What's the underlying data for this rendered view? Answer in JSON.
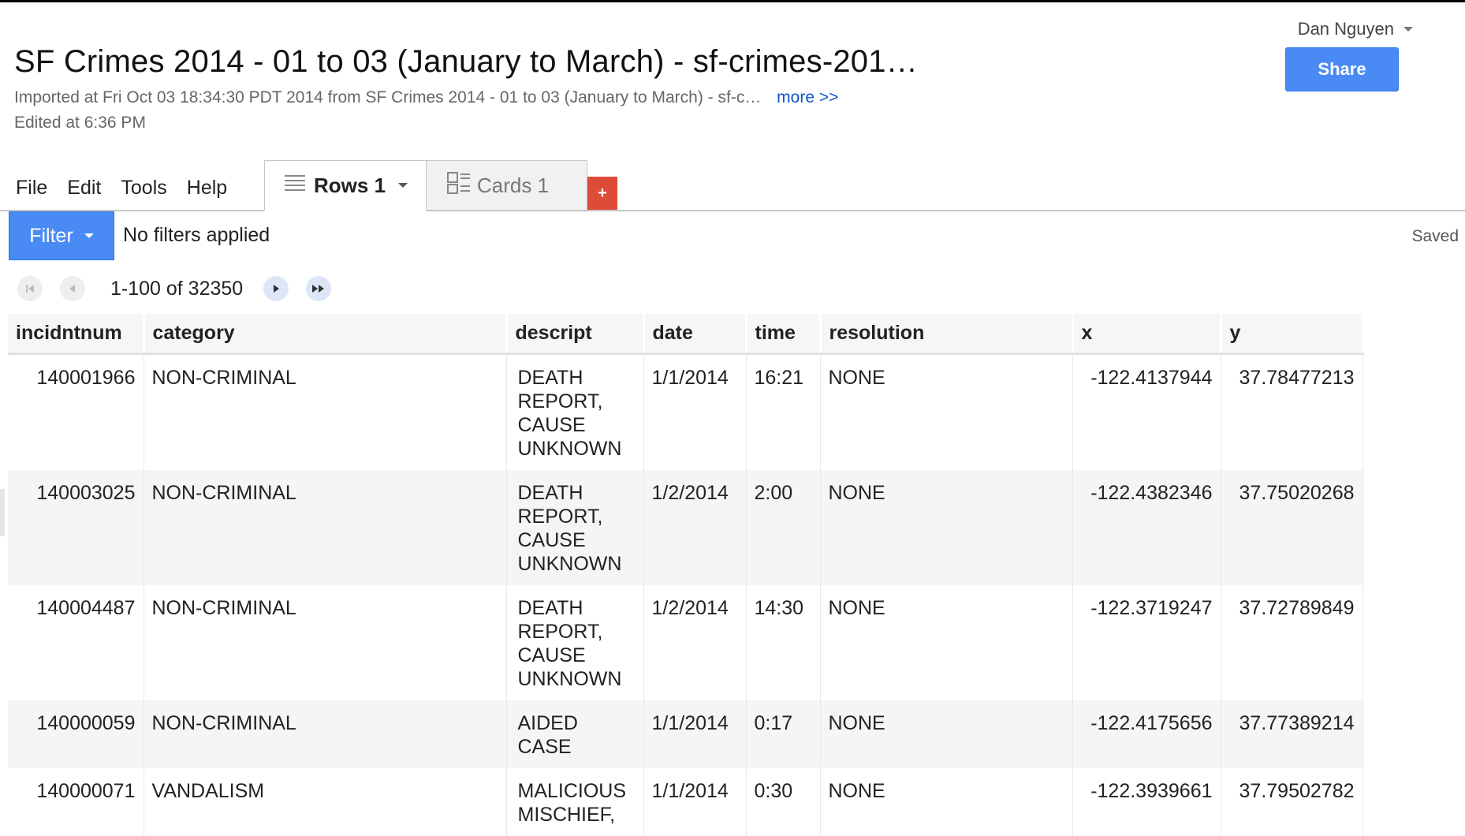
{
  "user": {
    "name": "Dan Nguyen"
  },
  "share_label": "Share",
  "doc": {
    "title": "SF Crimes 2014 - 01 to 03 (January to March) - sf-crimes-201…",
    "imported": "Imported at Fri Oct 03 18:34:30 PDT 2014 from SF Crimes 2014 - 01 to 03 (January to March) - sf-c…",
    "more": "more >>",
    "edited": "Edited at 6:36 PM"
  },
  "menu": [
    "File",
    "Edit",
    "Tools",
    "Help"
  ],
  "tabs": {
    "rows": "Rows 1",
    "cards": "Cards 1",
    "add": "+"
  },
  "filter": {
    "label": "Filter",
    "status": "No filters applied"
  },
  "save_status": "Saved",
  "pager": {
    "range": "1-100 of 32350"
  },
  "table": {
    "columns": [
      "incidntnum",
      "category",
      "descript",
      "date",
      "time",
      "resolution",
      "x",
      "y"
    ],
    "rows": [
      [
        "140001966",
        "NON-CRIMINAL",
        "DEATH REPORT, CAUSE UNKNOWN",
        "1/1/2014",
        "16:21",
        "NONE",
        "-122.4137944",
        "37.78477213"
      ],
      [
        "140003025",
        "NON-CRIMINAL",
        "DEATH REPORT, CAUSE UNKNOWN",
        "1/2/2014",
        "2:00",
        "NONE",
        "-122.4382346",
        "37.75020268"
      ],
      [
        "140004487",
        "NON-CRIMINAL",
        "DEATH REPORT, CAUSE UNKNOWN",
        "1/2/2014",
        "14:30",
        "NONE",
        "-122.3719247",
        "37.72789849"
      ],
      [
        "140000059",
        "NON-CRIMINAL",
        "AIDED CASE",
        "1/1/2014",
        "0:17",
        "NONE",
        "-122.4175656",
        "37.77389214"
      ],
      [
        "140000071",
        "VANDALISM",
        "MALICIOUS MISCHIEF,",
        "1/1/2014",
        "0:30",
        "NONE",
        "-122.3939661",
        "37.79502782"
      ]
    ]
  },
  "icons": {
    "rows_tab": "list-icon",
    "cards_tab": "cards-icon",
    "pager": [
      "first-page-icon",
      "prev-page-icon",
      "next-page-icon",
      "last-page-icon"
    ]
  }
}
